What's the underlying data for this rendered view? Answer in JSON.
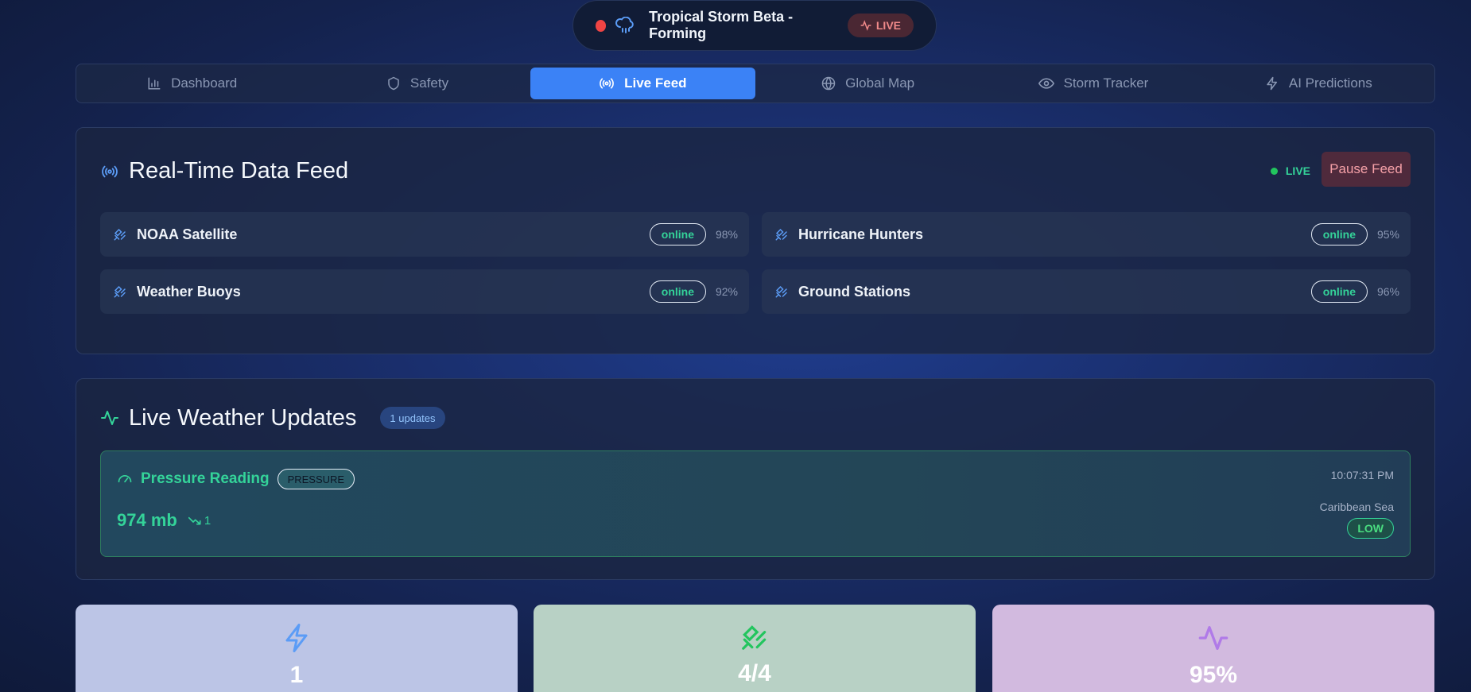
{
  "header": {
    "storm_title": "Tropical Storm Beta - Forming",
    "live_label": "LIVE"
  },
  "tabs": [
    {
      "label": "Dashboard",
      "icon": "bar-chart-icon",
      "active": false
    },
    {
      "label": "Safety",
      "icon": "shield-icon",
      "active": false
    },
    {
      "label": "Live Feed",
      "icon": "radio-icon",
      "active": true
    },
    {
      "label": "Global Map",
      "icon": "globe-icon",
      "active": false
    },
    {
      "label": "Storm Tracker",
      "icon": "eye-icon",
      "active": false
    },
    {
      "label": "AI Predictions",
      "icon": "zap-icon",
      "active": false
    }
  ],
  "feed": {
    "title": "Real-Time Data Feed",
    "live_label": "LIVE",
    "pause_label": "Pause Feed",
    "sources": [
      {
        "name": "NOAA Satellite",
        "status": "online",
        "pct": "98%"
      },
      {
        "name": "Hurricane Hunters",
        "status": "online",
        "pct": "95%"
      },
      {
        "name": "Weather Buoys",
        "status": "online",
        "pct": "92%"
      },
      {
        "name": "Ground Stations",
        "status": "online",
        "pct": "96%"
      }
    ]
  },
  "updates": {
    "title": "Live Weather Updates",
    "count_label": "1 updates",
    "items": [
      {
        "title": "Pressure Reading",
        "type": "PRESSURE",
        "value": "974 mb",
        "trend": "1",
        "time": "10:07:31 PM",
        "location": "Caribbean Sea",
        "level": "LOW"
      }
    ]
  },
  "stats": [
    {
      "value": "1",
      "icon": "zap-icon",
      "bg": "#bcc5e6",
      "color": "#5b9cf6"
    },
    {
      "value": "4/4",
      "icon": "satellite-icon",
      "bg": "#b8d1c5",
      "color": "#22c55e"
    },
    {
      "value": "95%",
      "icon": "activity-icon",
      "bg": "#d2badf",
      "color": "#b07ae8"
    }
  ],
  "colors": {
    "accent": "#3b82f6",
    "success": "#34d399",
    "danger": "#ef4444"
  }
}
